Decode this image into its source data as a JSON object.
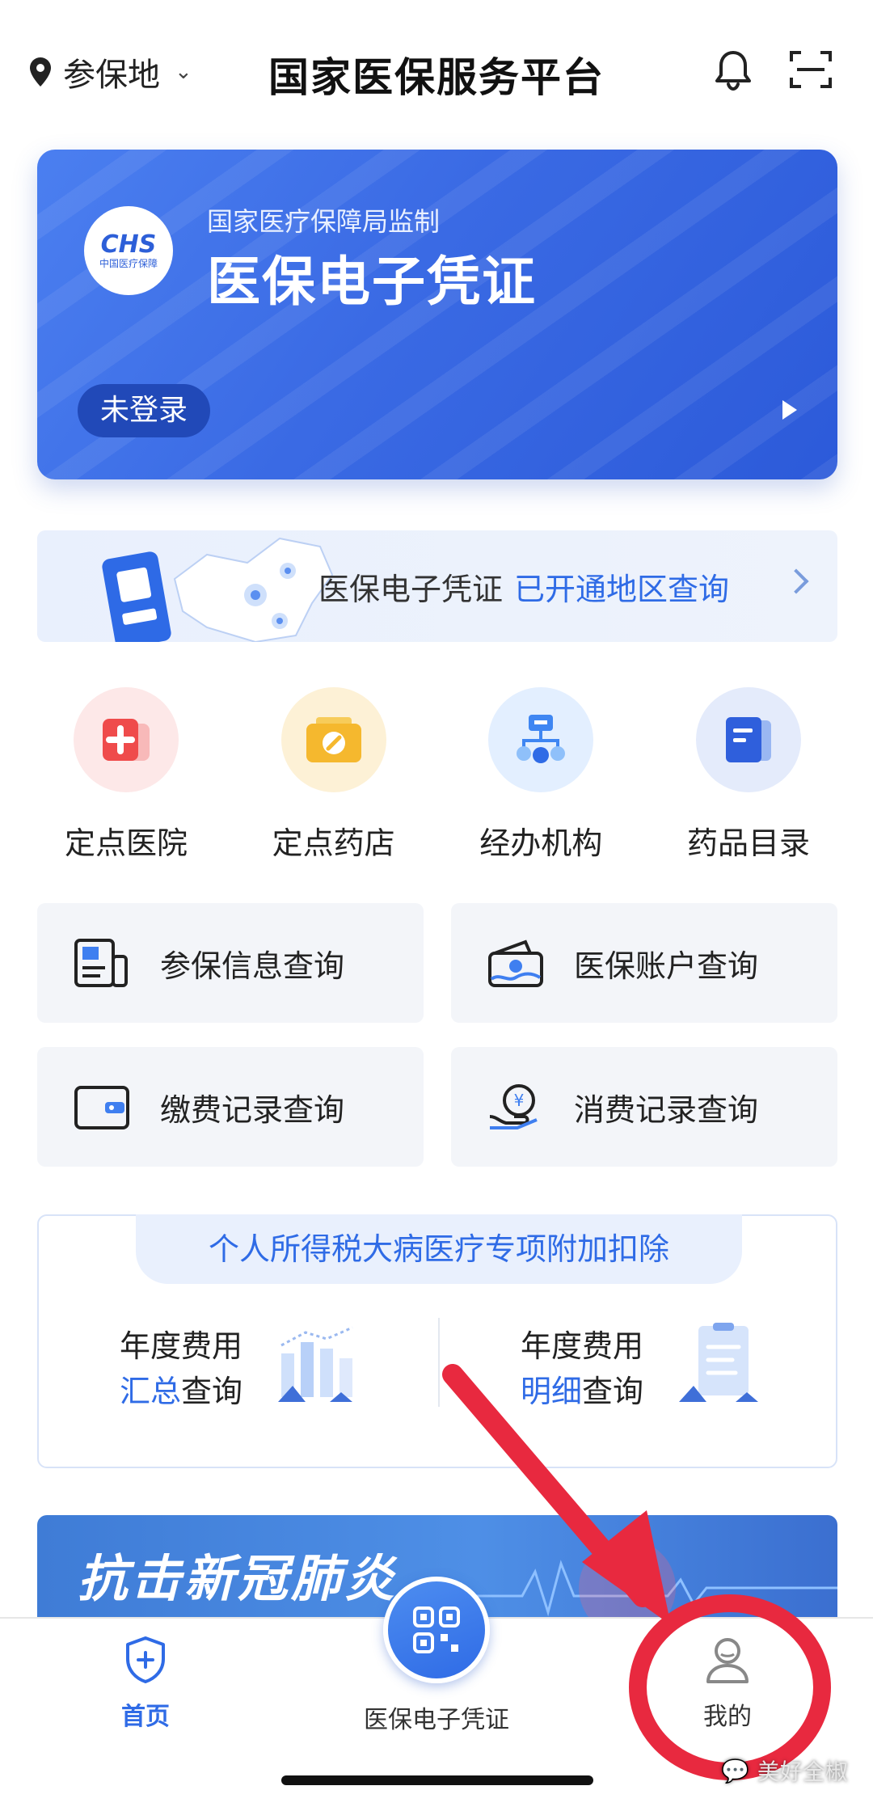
{
  "header": {
    "location_label": "参保地",
    "title": "国家医保服务平台"
  },
  "card": {
    "logo_text": "CHS",
    "logo_sub": "中国医疗保障",
    "subtitle": "国家医疗保障局监制",
    "title": "医保电子凭证",
    "status": "未登录"
  },
  "region_banner": {
    "text": "医保电子凭证",
    "highlight": "已开通地区查询"
  },
  "quick_icons": [
    {
      "label": "定点医院",
      "icon": "hospital-icon"
    },
    {
      "label": "定点药店",
      "icon": "pharmacy-icon"
    },
    {
      "label": "经办机构",
      "icon": "agency-icon"
    },
    {
      "label": "药品目录",
      "icon": "drug-catalog-icon"
    }
  ],
  "tiles": [
    {
      "label": "参保信息查询",
      "icon": "insurance-info-icon"
    },
    {
      "label": "医保账户查询",
      "icon": "account-icon"
    },
    {
      "label": "缴费记录查询",
      "icon": "wallet-icon"
    },
    {
      "label": "消费记录查询",
      "icon": "consumption-icon"
    }
  ],
  "tax": {
    "header": "个人所得税大病医疗专项附加扣除",
    "left": {
      "line1": "年度费用",
      "hl": "汇总",
      "rest": "查询"
    },
    "right": {
      "line1": "年度费用",
      "hl": "明细",
      "rest": "查询"
    }
  },
  "covid_banner": {
    "text": "抗击新冠肺炎"
  },
  "nav": {
    "home": "首页",
    "center": "医保电子凭证",
    "me": "我的"
  },
  "watermark": "美好全椒",
  "colors": {
    "primary": "#2f6be6",
    "card": "#3a6ae4",
    "annotation": "#e8293f"
  }
}
